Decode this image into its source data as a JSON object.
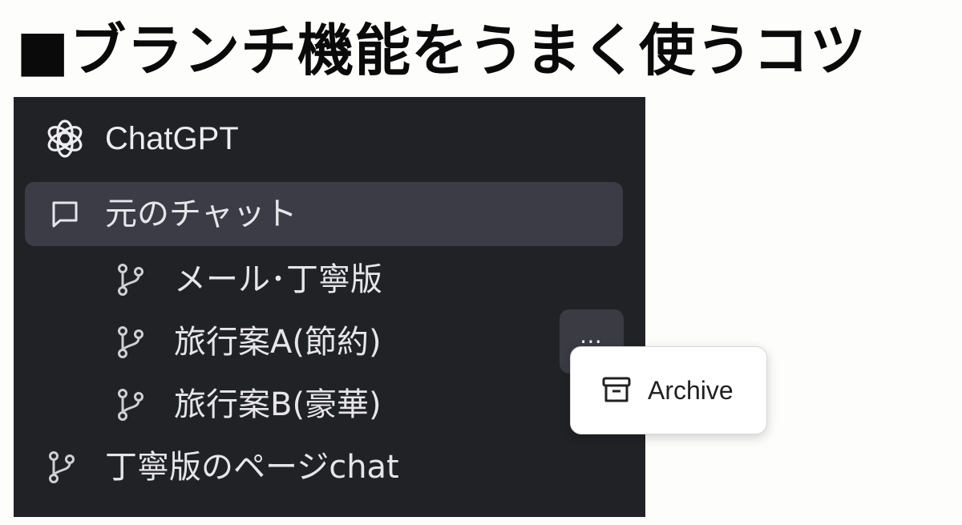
{
  "headline": "■ブランチ機能をうまく使うコツ",
  "app": {
    "name": "ChatGPT",
    "logo_icon": "openai-logo-icon"
  },
  "sidebar": {
    "active_item": {
      "label": "元のチャット",
      "icon": "chat-bubble-icon"
    },
    "branches": [
      {
        "label": "メール･丁寧版",
        "icon": "branch-icon"
      },
      {
        "label": "旅行案A(節約)",
        "icon": "branch-icon"
      },
      {
        "label": "旅行案B(豪華)",
        "icon": "branch-icon"
      },
      {
        "label": "丁寧版のページchat",
        "icon": "branch-icon"
      }
    ],
    "more_button_label": "⋯"
  },
  "context_menu": {
    "items": [
      {
        "label": "Archive",
        "icon": "archive-icon"
      }
    ]
  },
  "colors": {
    "sidebar_bg": "#212226",
    "active_bg": "#3c3c46",
    "text": "#e6e6ea",
    "menu_bg": "#ffffff"
  }
}
